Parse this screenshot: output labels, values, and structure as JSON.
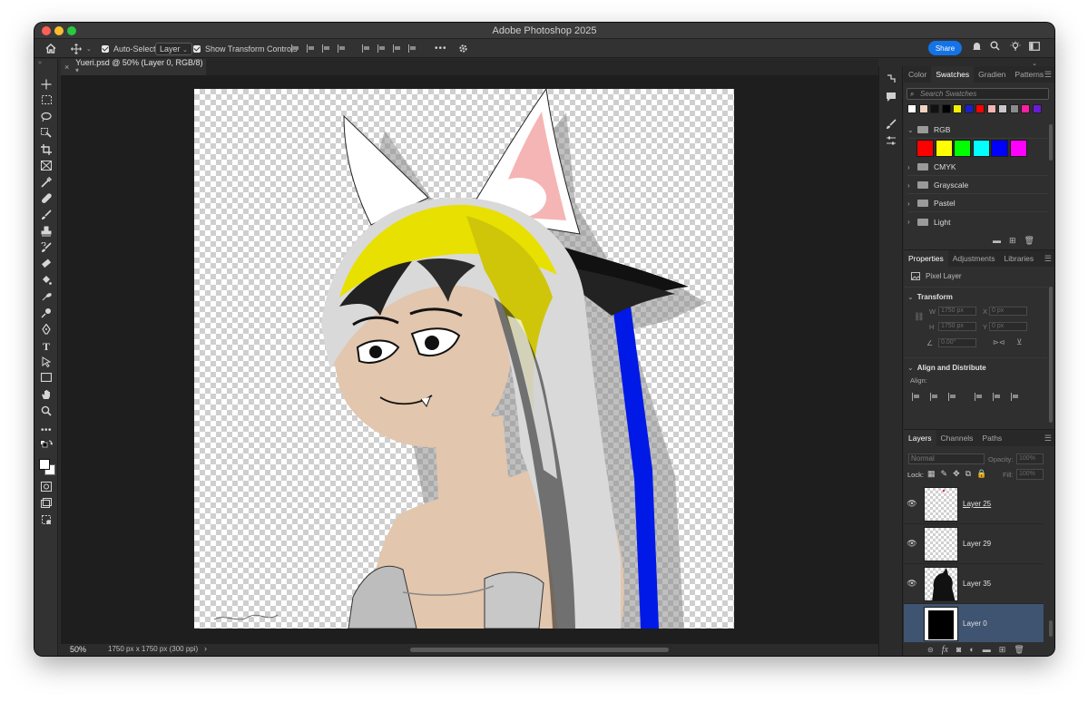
{
  "window": {
    "title": "Adobe Photoshop 2025"
  },
  "options_bar": {
    "auto_select_label": "Auto-Select:",
    "auto_select_value": "Layer",
    "show_transform_label": "Show Transform Controls",
    "more": "•••",
    "share": "Share"
  },
  "document_tab": {
    "close": "×",
    "title": "Yueri.psd @ 50% (Layer 0, RGB/8) *"
  },
  "status": {
    "zoom": "50%",
    "doc_info": "1750 px x 1750 px (300 ppi)",
    "arrow": "›"
  },
  "swatches_panel": {
    "tabs": [
      "Color",
      "Swatches",
      "Gradien",
      "Patterns"
    ],
    "active_tab": "Swatches",
    "search_placeholder": "Search Swatches",
    "recent_swatches": [
      "#ffffff",
      "#f2d3c1",
      "#111111",
      "#000000",
      "#f7f000",
      "#1a20c8",
      "#ff0000",
      "#f5b3b3",
      "#c8c8c8",
      "#8a8a8a",
      "#ff1da5",
      "#6a1ad8"
    ],
    "folders": [
      {
        "name": "RGB",
        "expanded": true
      },
      {
        "name": "CMYK",
        "expanded": false
      },
      {
        "name": "Grayscale",
        "expanded": false
      },
      {
        "name": "Pastel",
        "expanded": false
      },
      {
        "name": "Light",
        "expanded": false
      }
    ],
    "rgb_swatches": [
      "#ff0000",
      "#ffff00",
      "#00ff00",
      "#00ffff",
      "#0000ff",
      "#ff00ff"
    ]
  },
  "properties_panel": {
    "tabs": [
      "Properties",
      "Adjustments",
      "Libraries"
    ],
    "active_tab": "Properties",
    "layer_type": "Pixel Layer",
    "transform_title": "Transform",
    "w_label": "W",
    "w_value": "1750 px",
    "x_label": "X",
    "x_value": "0 px",
    "h_label": "H",
    "h_value": "1750 px",
    "y_label": "Y",
    "y_value": "0 px",
    "angle_value": "0.00°",
    "align_title": "Align and Distribute",
    "align_label": "Align:"
  },
  "layers_panel": {
    "tabs": [
      "Layers",
      "Channels",
      "Paths"
    ],
    "active_tab": "Layers",
    "blend_mode": "Normal",
    "opacity_label": "Opacity:",
    "opacity_value": "100%",
    "lock_label": "Lock:",
    "fill_label": "Fill:",
    "fill_value": "100%",
    "layers": [
      {
        "name": "Layer 25",
        "visible": true,
        "selected": false
      },
      {
        "name": "Layer 29",
        "visible": true,
        "selected": false
      },
      {
        "name": "Layer 35",
        "visible": true,
        "selected": false
      },
      {
        "name": "Layer 0",
        "visible": false,
        "selected": true
      }
    ],
    "footer_fx": "fx"
  },
  "icons": {
    "home": "home-icon",
    "move": "move-icon",
    "gear": "gear-icon",
    "bell": "bell-icon",
    "search": "search-icon",
    "lightbulb": "lightbulb-icon",
    "eye": "eye-icon",
    "folder": "folder-icon",
    "trash": "trash-icon"
  },
  "colors": {
    "accent": "#1473e6",
    "selected_layer": "#3e5470",
    "ps_panel": "#2f2f2f"
  }
}
